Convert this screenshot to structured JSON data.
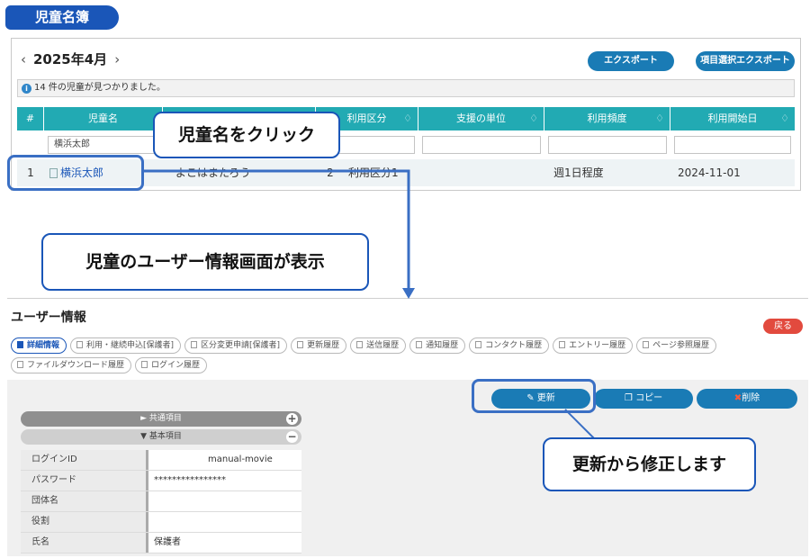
{
  "page_tag": "児童名簿",
  "roster": {
    "month": "2025年4月",
    "prev_icon": "chevron-left-icon",
    "next_icon": "chevron-right-icon",
    "export_label": "エクスポート",
    "select_export_label": "項目選択エクスポート",
    "info_icon": "info-icon",
    "info_text": "14 件の児童が見つかりました。",
    "columns": [
      "#",
      "児童名",
      "",
      "利用区分",
      "支援の単位",
      "利用頻度",
      "利用開始日"
    ],
    "filter_value": "横浜太郎",
    "row": {
      "num": "1",
      "name": "横浜太郎",
      "kana": "よこはまたろう",
      "category_num": "2",
      "category": "利用区分1",
      "unit": "",
      "frequency": "週1日程度",
      "start_date": "2024-11-01"
    }
  },
  "callouts": {
    "click_name": "児童名をクリック",
    "shows_screen": "児童のユーザー情報画面が表示",
    "update_note": "更新から修正します"
  },
  "user_info": {
    "title": "ユーザー情報",
    "back_label": "戻る",
    "tabs": [
      "詳細情報",
      "利用・継続申込[保護者]",
      "区分変更申請[保護者]",
      "更新履歴",
      "送信履歴",
      "通知履歴",
      "コンタクト履歴",
      "エントリー履歴",
      "ページ参照履歴",
      "ファイルダウンロード履歴",
      "ログイン履歴"
    ],
    "update_label": "更新",
    "copy_label": "コピー",
    "delete_label": "削除",
    "section_common": "► 共通項目",
    "section_basic": "▼ 基本項目",
    "fields": [
      {
        "label": "ログインID",
        "value": "manual-movie"
      },
      {
        "label": "パスワード",
        "value": "****************"
      },
      {
        "label": "団体名",
        "value": ""
      },
      {
        "label": "役割",
        "value": ""
      },
      {
        "label": "氏名",
        "value": "保護者"
      }
    ]
  },
  "colors": {
    "accent": "#1a56b8",
    "table_header": "#22aab3",
    "button": "#1a7bb5",
    "danger": "#e24a3e"
  }
}
